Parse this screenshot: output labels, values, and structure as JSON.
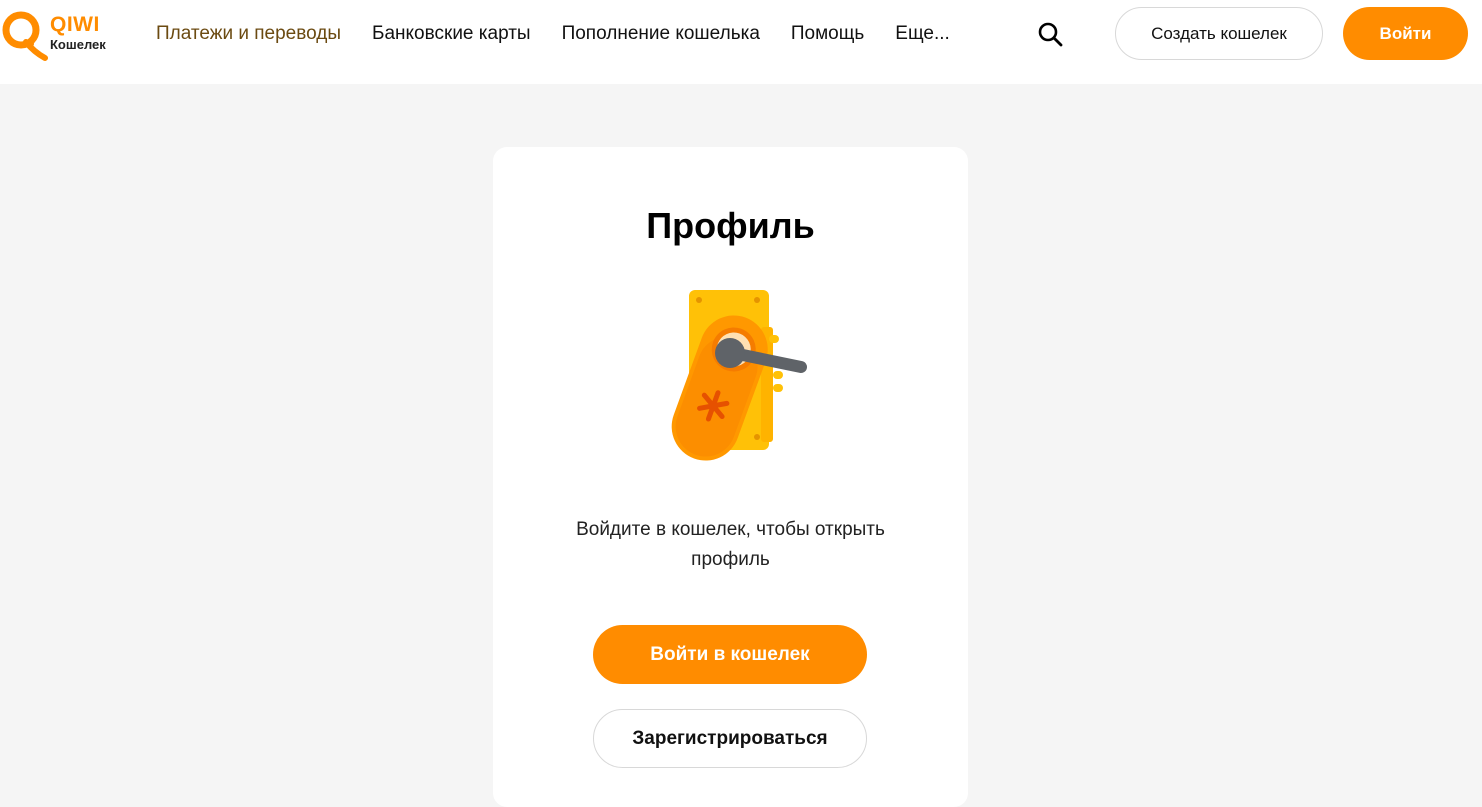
{
  "header": {
    "logo": {
      "brand": "QIWI",
      "subtitle": "Кошелек",
      "icon": "qiwi-logo-icon",
      "color": "#ff8c00"
    },
    "nav": [
      {
        "label": "Платежи и переводы",
        "active": true
      },
      {
        "label": "Банковские карты",
        "active": false
      },
      {
        "label": "Пополнение кошелька",
        "active": false
      },
      {
        "label": "Помощь",
        "active": false
      },
      {
        "label": "Еще...",
        "active": false
      }
    ],
    "search_icon": "search-icon",
    "create_wallet_label": "Создать кошелек",
    "login_label": "Войти"
  },
  "card": {
    "title": "Профиль",
    "illustration": "door-lock-illustration",
    "message": "Войдите в кошелек, чтобы открыть профиль",
    "primary_button": "Войти в кошелек",
    "secondary_button": "Зарегистрироваться"
  },
  "colors": {
    "accent": "#ff8c00",
    "background": "#f5f5f5",
    "card": "#ffffff"
  }
}
